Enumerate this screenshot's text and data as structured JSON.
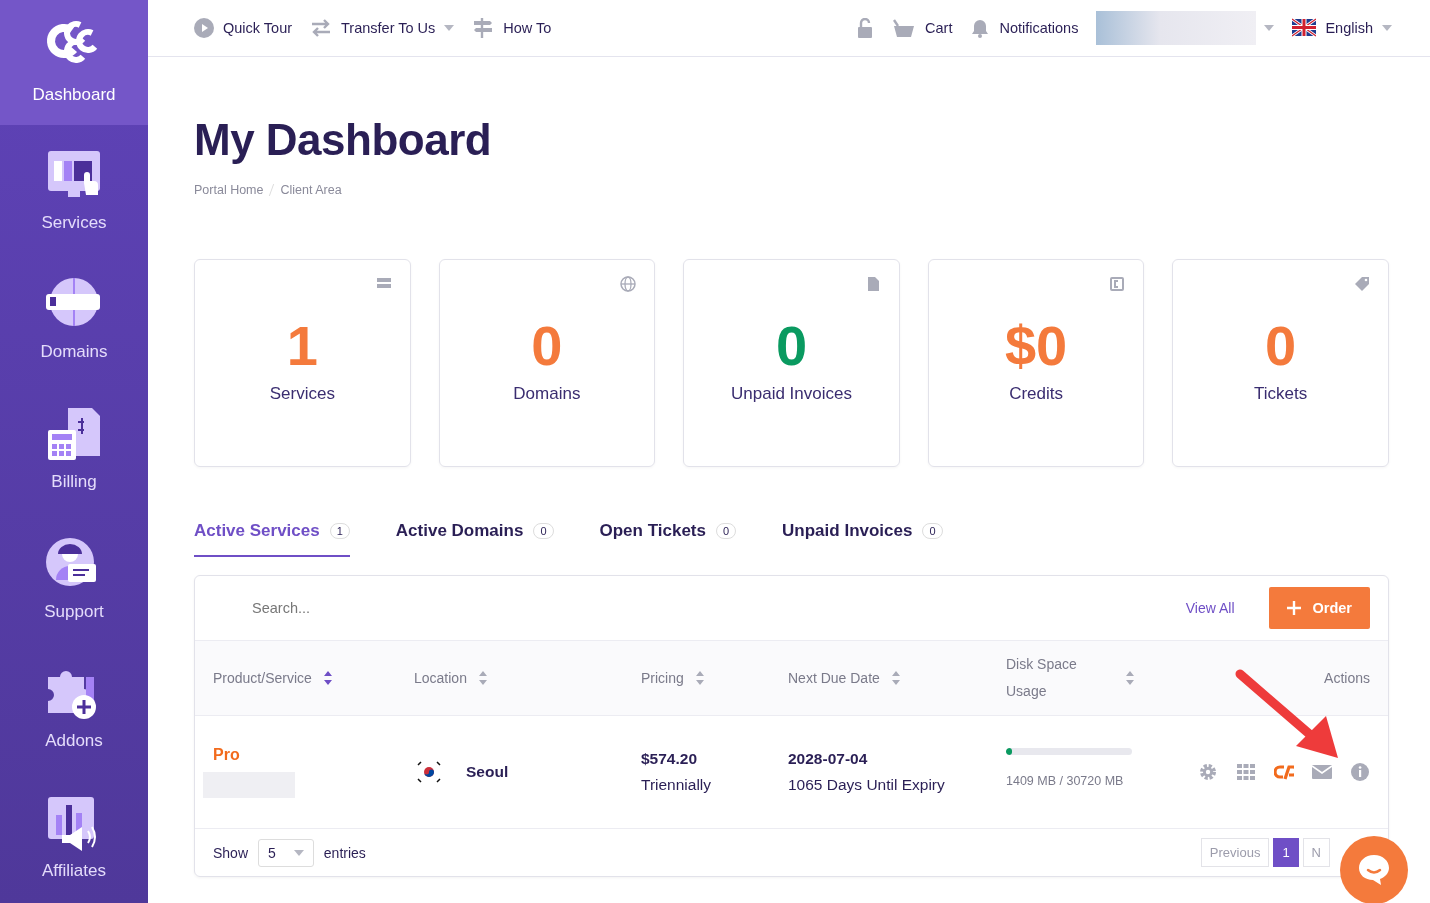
{
  "sidebar": {
    "items": [
      {
        "label": "Dashboard",
        "kind": "logo",
        "selected": true
      },
      {
        "label": "Services",
        "kind": "services",
        "selected": false
      },
      {
        "label": "Domains",
        "kind": "domains",
        "selected": false
      },
      {
        "label": "Billing",
        "kind": "billing",
        "selected": false
      },
      {
        "label": "Support",
        "kind": "support",
        "selected": false
      },
      {
        "label": "Addons",
        "kind": "addons",
        "selected": false
      },
      {
        "label": "Affiliates",
        "kind": "affiliates",
        "selected": false
      }
    ]
  },
  "topbar": {
    "left": [
      {
        "label": "Quick Tour",
        "kind": "play",
        "dropdown": false
      },
      {
        "label": "Transfer To Us",
        "kind": "transfer",
        "dropdown": true
      },
      {
        "label": "How To",
        "kind": "signpost",
        "dropdown": false
      }
    ],
    "right": [
      {
        "kind": "lock"
      },
      {
        "label": "Cart",
        "kind": "cart"
      },
      {
        "label": "Notifications",
        "kind": "bell"
      },
      {
        "kind": "account",
        "dropdown": true
      },
      {
        "label": "English",
        "kind": "flag",
        "dropdown": true
      }
    ]
  },
  "page": {
    "title": "My Dashboard",
    "breadcrumb": [
      "Portal Home",
      "Client Area"
    ]
  },
  "stats": [
    {
      "value": "1",
      "label": "Services",
      "kind": "server",
      "color": "#f47a3c"
    },
    {
      "value": "0",
      "label": "Domains",
      "kind": "globe",
      "color": "#f47a3c"
    },
    {
      "value": "0",
      "label": "Unpaid Invoices",
      "kind": "file",
      "color": "#0a9a60"
    },
    {
      "value": "$0",
      "label": "Credits",
      "kind": "credit",
      "color": "#f47a3c"
    },
    {
      "value": "0",
      "label": "Tickets",
      "kind": "tag",
      "color": "#f47a3c"
    }
  ],
  "tabs": [
    {
      "label": "Active Services",
      "count": "1",
      "selected": true
    },
    {
      "label": "Active Domains",
      "count": "0",
      "selected": false
    },
    {
      "label": "Open Tickets",
      "count": "0",
      "selected": false
    },
    {
      "label": "Unpaid Invoices",
      "count": "0",
      "selected": false
    }
  ],
  "panel": {
    "search": {
      "placeholder": "Search..."
    },
    "view_all": "View All",
    "order_button": "Order",
    "table": {
      "columns": [
        {
          "label": "Product/Service",
          "sorted": true
        },
        {
          "label": "Location",
          "sorted": false
        },
        {
          "label": "Pricing",
          "sorted": false
        },
        {
          "label": "Next Due Date",
          "sorted": false
        },
        {
          "label": "Disk Space Usage",
          "sorted": false
        },
        {
          "label": "Actions"
        }
      ],
      "rows": [
        {
          "product": "Pro",
          "location": "Seoul",
          "price": "$574.20",
          "cycle": "Triennially",
          "due": "2028-07-04",
          "expiry": "1065 Days Until Expiry",
          "disk": {
            "level": 0.045,
            "reading": "1409 MB / 30720 MB"
          },
          "actions": [
            {
              "kind": "gear"
            },
            {
              "kind": "grid"
            },
            {
              "kind": "cpanel"
            },
            {
              "kind": "mail"
            },
            {
              "kind": "info"
            }
          ]
        }
      ]
    },
    "footer": {
      "show": "Show",
      "entries_value": "5",
      "entries": "entries",
      "pagination": [
        {
          "label": "Previous",
          "disabled": true,
          "selected": false
        },
        {
          "label": "1",
          "disabled": false,
          "selected": true
        },
        {
          "label": "N",
          "disabled": true,
          "selected": false
        }
      ]
    }
  }
}
